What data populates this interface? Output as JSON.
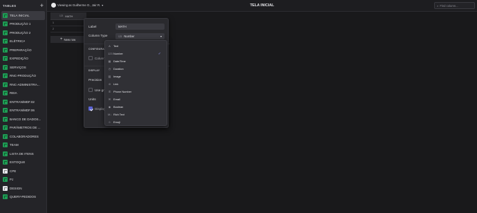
{
  "sidebar": {
    "title": "TABLES",
    "add_label": "+",
    "items": [
      {
        "label": "TELA INICIAL",
        "active": true,
        "icon": "home-table-icon"
      },
      {
        "label": "PRODUÇÃO 1"
      },
      {
        "label": "PRODUÇÃO 2"
      },
      {
        "label": "ELÉTRICA"
      },
      {
        "label": "PREPARAÇÃO"
      },
      {
        "label": "EXPEDIÇÃO"
      },
      {
        "label": "SERVIÇOS"
      },
      {
        "label": "RNC-PRODUÇÃO"
      },
      {
        "label": "RNC-ADMINISTRA..."
      },
      {
        "label": "REIA"
      },
      {
        "label": "ENTRAN/MDF.02"
      },
      {
        "label": "ENTRAN/MDF.06"
      },
      {
        "label": "BANCO DE DADOS..."
      },
      {
        "label": "PARÂMETROS DE ..."
      },
      {
        "label": "COLABORADORES"
      },
      {
        "label": "TEAM"
      },
      {
        "label": "LISTA DE ITENS"
      },
      {
        "label": "ESTOQUE"
      },
      {
        "label": "CPE",
        "icon": "white"
      },
      {
        "label": "PJ"
      },
      {
        "label": "DESIGN",
        "icon": "white"
      },
      {
        "label": "QUERY-PEDIDOS"
      }
    ]
  },
  "topbar": {
    "viewing_label": "Viewing as Guilherme O., Jair R.",
    "page_title": "TELA INICIAL",
    "search_placeholder": "Find column..."
  },
  "grid": {
    "column_header": "MATH",
    "column_type_glyph": "123",
    "rows": [
      "1",
      "2"
    ],
    "new_row_label": "New row"
  },
  "column_editor": {
    "label_caption": "Label",
    "label_value": "MATH",
    "type_caption": "Column Type",
    "type_value": "Number",
    "type_glyph": "123",
    "configure_section": "CONFIGURAR",
    "column_checkbox_label": "Colunm",
    "display_section": "DISPLAY",
    "precision_label": "Precision",
    "use_group_label": "Use gr",
    "units_label": "Units",
    "display_checkbox_label": "Display"
  },
  "type_menu": {
    "selected": "Number",
    "items": [
      {
        "label": "Text",
        "icon": "text-icon",
        "glyph": "A"
      },
      {
        "label": "Number",
        "icon": "number-icon",
        "glyph": "123"
      },
      {
        "label": "Date/Time",
        "icon": "calendar-icon",
        "glyph": "▦"
      },
      {
        "label": "Duration",
        "icon": "clock-icon",
        "glyph": "◷"
      },
      {
        "label": "Image",
        "icon": "image-icon",
        "glyph": "▨"
      },
      {
        "label": "Link",
        "icon": "link-icon",
        "glyph": "⊘"
      },
      {
        "label": "Phone Number",
        "icon": "phone-icon",
        "glyph": "✆"
      },
      {
        "label": "Email",
        "icon": "email-icon",
        "glyph": "✉"
      },
      {
        "label": "Boolean",
        "icon": "toggle-icon",
        "glyph": "◉"
      },
      {
        "label": "Rich Text",
        "icon": "rich-text-icon",
        "glyph": "M↓"
      },
      {
        "label": "Emoji",
        "icon": "emoji-icon",
        "glyph": "☺"
      }
    ]
  },
  "colors": {
    "accent": "#5b63d3",
    "table_icon": "#1f9d55",
    "background": "#19191b"
  }
}
